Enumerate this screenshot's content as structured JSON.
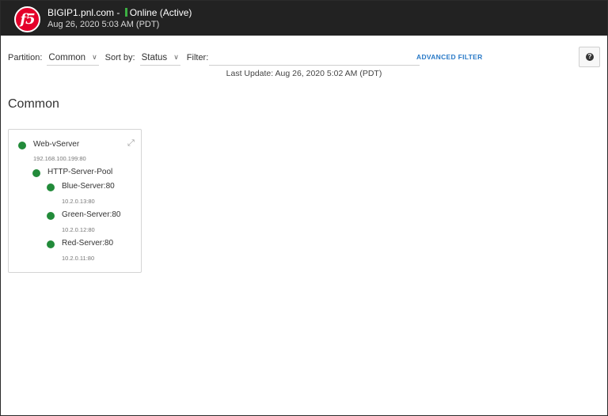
{
  "header": {
    "hostname": "BIGIP1.pnl.com -",
    "status": "Online (Active)",
    "status_color": "#3cb043",
    "datetime": "Aug 26, 2020 5:03 AM (PDT)",
    "logo_text": "f5"
  },
  "toolbar": {
    "partition_label": "Partition:",
    "partition_value": "Common",
    "sortby_label": "Sort by:",
    "sortby_value": "Status",
    "filter_label": "Filter:",
    "filter_value": "",
    "advanced_filter": "ADVANCED FILTER",
    "help_icon": "question-icon"
  },
  "last_update": "Last Update: Aug 26, 2020 5:02 AM (PDT)",
  "section_title": "Common",
  "tree": {
    "virtual_server": {
      "name": "Web-vServer",
      "address": "192.168.100.199:80",
      "status_color": "#228b3a"
    },
    "pool": {
      "name": "HTTP-Server-Pool",
      "status_color": "#228b3a"
    },
    "members": [
      {
        "name": "Blue-Server:80",
        "address": "10.2.0.13:80",
        "status_color": "#228b3a"
      },
      {
        "name": "Green-Server:80",
        "address": "10.2.0.12:80",
        "status_color": "#228b3a"
      },
      {
        "name": "Red-Server:80",
        "address": "10.2.0.11:80",
        "status_color": "#228b3a"
      }
    ]
  }
}
